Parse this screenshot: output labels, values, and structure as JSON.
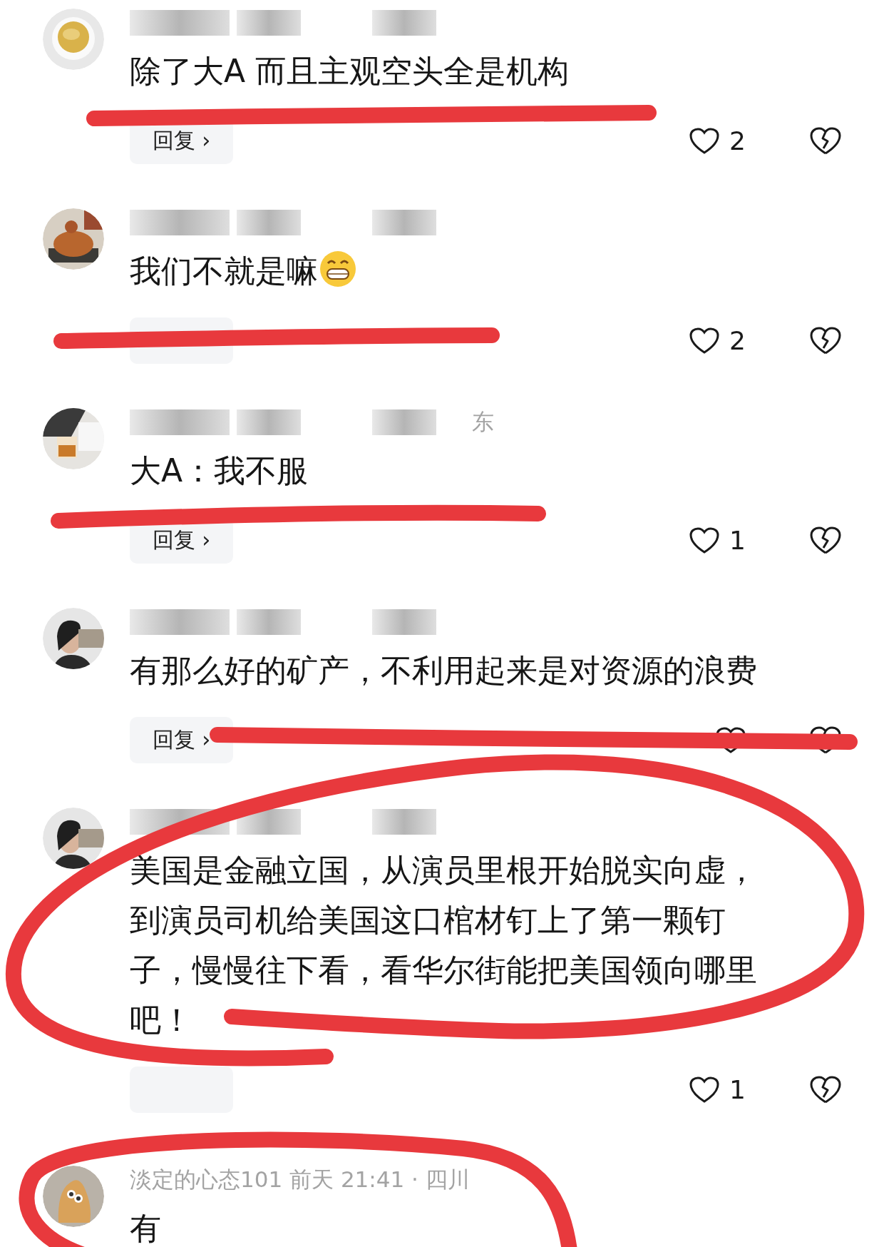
{
  "comments": [
    {
      "name_hidden": true,
      "text": "除了大A 而且主观空头全是机构",
      "reply": "回复 ›",
      "likes": "2"
    },
    {
      "name_hidden": true,
      "text": "我们不就是嘛",
      "emoji": true,
      "likes": "2"
    },
    {
      "name_hidden": true,
      "meta": "东",
      "text": "大A：我不服",
      "reply": "回复 ›",
      "likes": "1"
    },
    {
      "name_hidden": true,
      "text": "有那么好的矿产，不利用起来是对资源的浪费",
      "reply": "回复 ›"
    },
    {
      "name_hidden": true,
      "text": "美国是金融立国，从演员里根开始脱实向虚，到演员司机给美国这口棺材钉上了第一颗钉子，慢慢往下看，看华尔街能把美国领向哪里吧！",
      "likes": "1"
    },
    {
      "name_hidden": false,
      "meta": "淡定的心态101  前天 21:41 · 四川",
      "text": "有"
    }
  ]
}
